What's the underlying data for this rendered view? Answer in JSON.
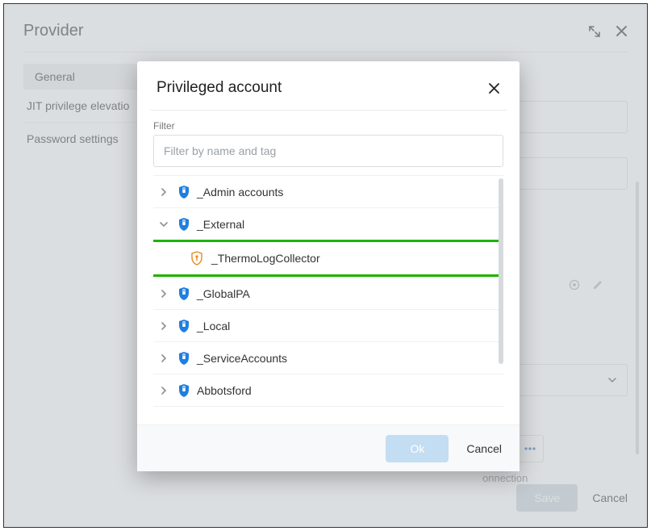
{
  "header": {
    "title": "Provider"
  },
  "sidebar": {
    "tab_general": "General",
    "row_jit": "JIT privilege elevatio",
    "row_pwd": "Password settings"
  },
  "footer": {
    "save": "Save",
    "cancel": "Cancel"
  },
  "bg": {
    "connection_hint": "onnection"
  },
  "modal": {
    "title": "Privileged account",
    "filter_label": "Filter",
    "filter_placeholder": "Filter by name and tag",
    "ok": "Ok",
    "cancel": "Cancel"
  },
  "tree": {
    "items": [
      {
        "label": "_Admin accounts"
      },
      {
        "label": "_External"
      },
      {
        "label": "_GlobalPA"
      },
      {
        "label": "_Local"
      },
      {
        "label": "_ServiceAccounts"
      },
      {
        "label": "Abbotsford"
      }
    ],
    "child": {
      "label": "_ThermoLogCollector"
    }
  }
}
